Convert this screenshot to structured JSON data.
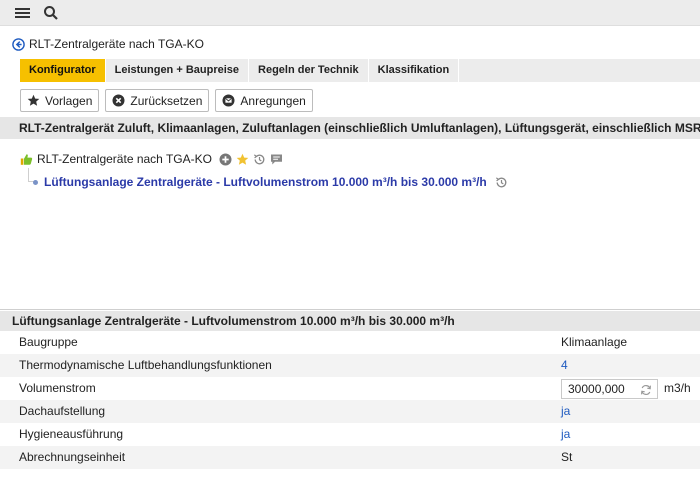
{
  "topbar": {
    "menu_icon": "hamburger-menu-icon",
    "search_icon": "search-icon"
  },
  "back": {
    "label": "RLT-Zentralgeräte nach TGA-KO"
  },
  "tabs": [
    {
      "label": "Konfigurator",
      "active": true
    },
    {
      "label": "Leistungen + Baupreise",
      "active": false
    },
    {
      "label": "Regeln der Technik",
      "active": false
    },
    {
      "label": "Klassifikation",
      "active": false
    }
  ],
  "actions": {
    "vorlagen": "Vorlagen",
    "zuruecksetzen": "Zurücksetzen",
    "anregungen": "Anregungen"
  },
  "description": "RLT-Zentralgerät Zuluft, Klimaanlagen, Zuluftanlagen (einschließlich Umluftanlagen), Lüftungsgerät, einschließlich MSR-Technik,",
  "tree": {
    "root_label": "RLT-Zentralgeräte nach TGA-KO",
    "child_label": "Lüftungsanlage Zentralgeräte - Luftvolumenstrom 10.000 m³/h bis 30.000 m³/h"
  },
  "properties": {
    "title": "Lüftungsanlage Zentralgeräte - Luftvolumenstrom 10.000 m³/h bis 30.000 m³/h",
    "rows": [
      {
        "label": "Baugruppe",
        "value": "Klimaanlage"
      },
      {
        "label": "Thermodynamische Luftbehandlungsfunktionen",
        "value": "4"
      },
      {
        "label": "Volumenstrom",
        "value": "30000,000",
        "unit": "m3/h"
      },
      {
        "label": "Dachaufstellung",
        "value": "ja"
      },
      {
        "label": "Hygieneausführung",
        "value": "ja"
      },
      {
        "label": "Abrechnungseinheit",
        "value": "St"
      }
    ]
  },
  "colors": {
    "accent": "#f6c000",
    "link": "#1f5bc0",
    "tree_link": "#2b3aa8"
  }
}
